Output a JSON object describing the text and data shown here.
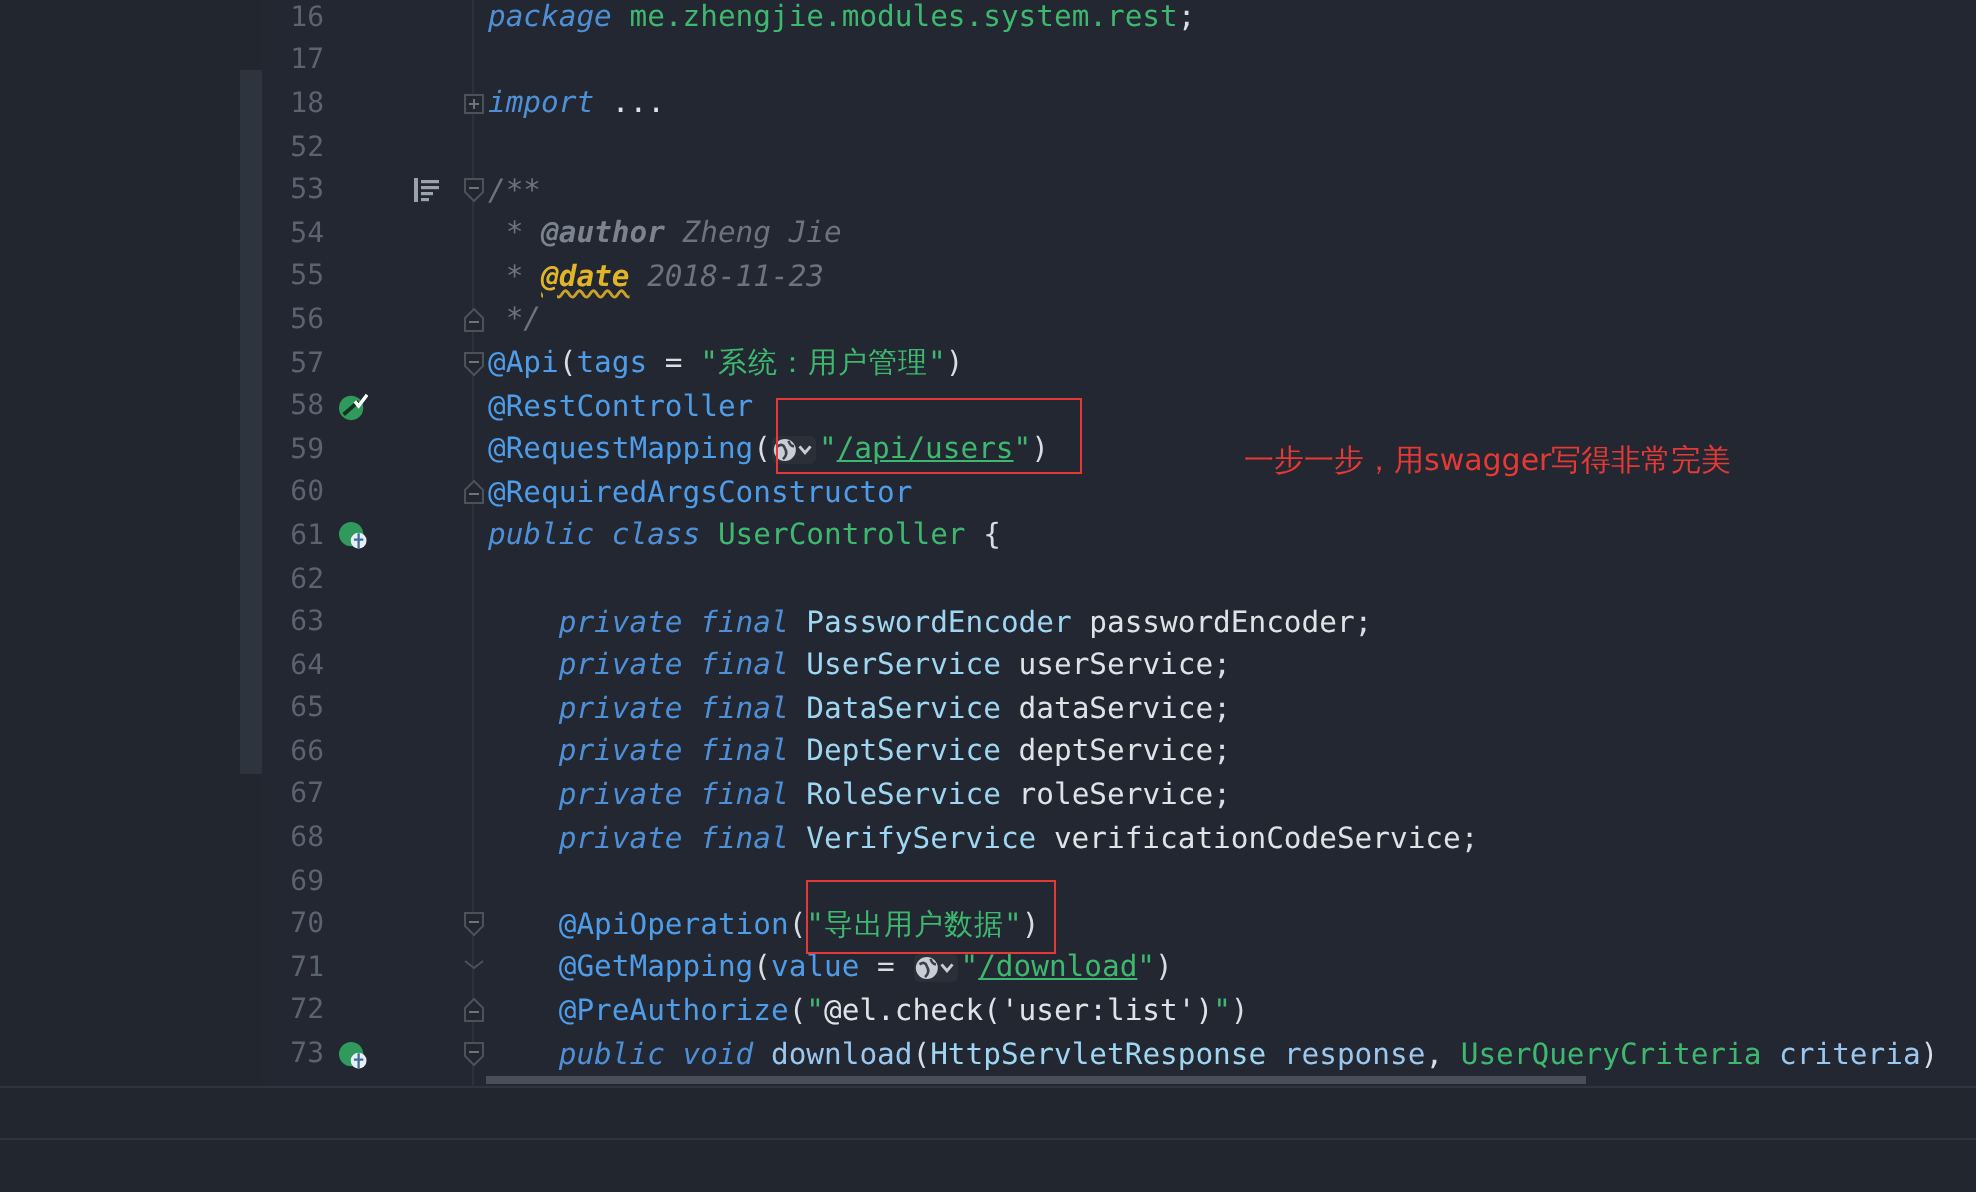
{
  "editor": {
    "lines": [
      {
        "number": "16",
        "tokens": [
          {
            "kind": "kw",
            "text": "package "
          },
          {
            "kind": "pkg",
            "text": "me.zhengjie.modules.system.rest"
          },
          {
            "kind": "punct",
            "text": ";"
          }
        ]
      },
      {
        "number": "17"
      },
      {
        "number": "18",
        "fold": {
          "kind": "collapsed"
        },
        "tokens": [
          {
            "kind": "kw",
            "text": "import "
          },
          {
            "kind": "id",
            "text": "..."
          }
        ]
      },
      {
        "number": "52"
      },
      {
        "number": "53",
        "gutter": {
          "kind": "doc"
        },
        "fold": {
          "kind": "open"
        },
        "tokens": [
          {
            "kind": "cm",
            "text": "/**"
          }
        ]
      },
      {
        "number": "54",
        "tokens": [
          {
            "kind": "cm",
            "text": " * "
          },
          {
            "kind": "cmtag",
            "text": "@author"
          },
          {
            "kind": "cm",
            "text": " Zheng Jie"
          }
        ]
      },
      {
        "number": "55",
        "tokens": [
          {
            "kind": "cm",
            "text": " * "
          },
          {
            "kind": "cmwarn",
            "text": "@date"
          },
          {
            "kind": "cm",
            "text": " 2018-11-23"
          }
        ]
      },
      {
        "number": "56",
        "fold": {
          "kind": "close"
        },
        "tokens": [
          {
            "kind": "cm",
            "text": " */"
          }
        ]
      },
      {
        "number": "57",
        "fold": {
          "kind": "open"
        },
        "tokens": [
          {
            "kind": "ann",
            "text": "@Api"
          },
          {
            "kind": "punct",
            "text": "("
          },
          {
            "kind": "ann",
            "text": "tags"
          },
          {
            "kind": "punct",
            "text": " = "
          },
          {
            "kind": "str",
            "text": "\"系统：用户管理\""
          },
          {
            "kind": "punct",
            "text": ")"
          }
        ]
      },
      {
        "number": "58",
        "gutter": {
          "kind": "bean"
        },
        "tokens": [
          {
            "kind": "ann",
            "text": "@RestController"
          }
        ]
      },
      {
        "number": "59",
        "tokens": [
          {
            "kind": "ann",
            "text": "@RequestMapping"
          },
          {
            "kind": "punct",
            "text": "("
          },
          {
            "kind": "hint"
          },
          {
            "kind": "str",
            "text": "\""
          },
          {
            "kind": "link",
            "text": "/api/users"
          },
          {
            "kind": "str",
            "text": "\""
          },
          {
            "kind": "punct",
            "text": ")"
          }
        ]
      },
      {
        "number": "60",
        "fold": {
          "kind": "close"
        },
        "tokens": [
          {
            "kind": "ann",
            "text": "@RequiredArgsConstructor"
          }
        ]
      },
      {
        "number": "61",
        "gutter": {
          "kind": "web"
        },
        "tokens": [
          {
            "kind": "kw",
            "text": "public class "
          },
          {
            "kind": "class",
            "text": "UserController"
          },
          {
            "kind": "punct",
            "text": " {"
          }
        ]
      },
      {
        "number": "62"
      },
      {
        "number": "63",
        "tokens": [
          {
            "kind": "kw",
            "text": "    private final "
          },
          {
            "kind": "type",
            "text": "PasswordEncoder "
          },
          {
            "kind": "id",
            "text": "passwordEncoder"
          },
          {
            "kind": "punct",
            "text": ";"
          }
        ]
      },
      {
        "number": "64",
        "tokens": [
          {
            "kind": "kw",
            "text": "    private final "
          },
          {
            "kind": "type",
            "text": "UserService "
          },
          {
            "kind": "id",
            "text": "userService"
          },
          {
            "kind": "punct",
            "text": ";"
          }
        ]
      },
      {
        "number": "65",
        "tokens": [
          {
            "kind": "kw",
            "text": "    private final "
          },
          {
            "kind": "type",
            "text": "DataService "
          },
          {
            "kind": "id",
            "text": "dataService"
          },
          {
            "kind": "punct",
            "text": ";"
          }
        ]
      },
      {
        "number": "66",
        "tokens": [
          {
            "kind": "kw",
            "text": "    private final "
          },
          {
            "kind": "type",
            "text": "DeptService "
          },
          {
            "kind": "id",
            "text": "deptService"
          },
          {
            "kind": "punct",
            "text": ";"
          }
        ]
      },
      {
        "number": "67",
        "tokens": [
          {
            "kind": "kw",
            "text": "    private final "
          },
          {
            "kind": "type",
            "text": "RoleService "
          },
          {
            "kind": "id",
            "text": "roleService"
          },
          {
            "kind": "punct",
            "text": ";"
          }
        ]
      },
      {
        "number": "68",
        "tokens": [
          {
            "kind": "kw",
            "text": "    private final "
          },
          {
            "kind": "type",
            "text": "VerifyService "
          },
          {
            "kind": "id",
            "text": "verificationCodeService"
          },
          {
            "kind": "punct",
            "text": ";"
          }
        ]
      },
      {
        "number": "69"
      },
      {
        "number": "70",
        "fold": {
          "kind": "open"
        },
        "tokens": [
          {
            "kind": "ann",
            "text": "    @ApiOperation"
          },
          {
            "kind": "punct",
            "text": "("
          },
          {
            "kind": "str",
            "text": "\"导出用户数据\""
          },
          {
            "kind": "punct",
            "text": ")"
          }
        ]
      },
      {
        "number": "71",
        "fold": {
          "kind": "mid"
        },
        "tokens": [
          {
            "kind": "ann",
            "text": "    @GetMapping"
          },
          {
            "kind": "punct",
            "text": "("
          },
          {
            "kind": "ann",
            "text": "value"
          },
          {
            "kind": "punct",
            "text": " = "
          },
          {
            "kind": "hint"
          },
          {
            "kind": "str",
            "text": "\""
          },
          {
            "kind": "link",
            "text": "/download"
          },
          {
            "kind": "str",
            "text": "\""
          },
          {
            "kind": "punct",
            "text": ")"
          }
        ]
      },
      {
        "number": "72",
        "fold": {
          "kind": "close"
        },
        "tokens": [
          {
            "kind": "ann",
            "text": "    @PreAuthorize"
          },
          {
            "kind": "punct",
            "text": "("
          },
          {
            "kind": "str",
            "text": "\""
          },
          {
            "kind": "id",
            "text": "@el.check('user:list')"
          },
          {
            "kind": "str",
            "text": "\""
          },
          {
            "kind": "punct",
            "text": ")"
          }
        ]
      },
      {
        "number": "73",
        "gutter": {
          "kind": "web"
        },
        "fold": {
          "kind": "open"
        },
        "tokens": [
          {
            "kind": "kw",
            "text": "    public void "
          },
          {
            "kind": "method",
            "text": "download"
          },
          {
            "kind": "punct",
            "text": "("
          },
          {
            "kind": "type",
            "text": "HttpServletResponse "
          },
          {
            "kind": "method",
            "text": "response"
          },
          {
            "kind": "punct",
            "text": ", "
          },
          {
            "kind": "class",
            "text": "UserQueryCriteria "
          },
          {
            "kind": "method",
            "text": "criteria"
          },
          {
            "kind": "punct",
            "text": ")"
          }
        ]
      }
    ]
  },
  "callout": {
    "text": "一步一步，用swagger写得非常完美"
  }
}
